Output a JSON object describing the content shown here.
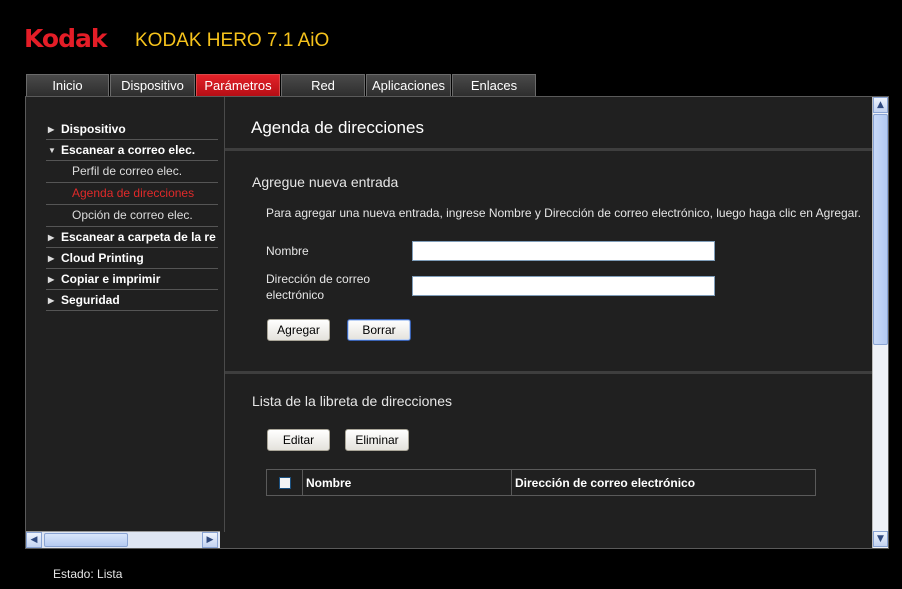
{
  "header": {
    "logo": "Kodak",
    "model": "KODAK HERO 7.1 AiO"
  },
  "tabs": [
    {
      "label": "Inicio",
      "active": false
    },
    {
      "label": "Dispositivo",
      "active": false
    },
    {
      "label": "Parámetros",
      "active": true
    },
    {
      "label": "Red",
      "active": false
    },
    {
      "label": "Aplicaciones",
      "active": false
    },
    {
      "label": "Enlaces",
      "active": false
    }
  ],
  "sidebar": {
    "items": [
      {
        "label": "Dispositivo",
        "expanded": false
      },
      {
        "label": "Escanear a correo elec.",
        "expanded": true
      },
      {
        "label": "Escanear a carpeta de la re",
        "expanded": false
      },
      {
        "label": "Cloud Printing",
        "expanded": false
      },
      {
        "label": "Copiar e imprimir",
        "expanded": false
      },
      {
        "label": "Seguridad",
        "expanded": false
      }
    ],
    "subitems": [
      {
        "label": "Perfil de correo elec.",
        "active": false
      },
      {
        "label": "Agenda de direcciones",
        "active": true
      },
      {
        "label": "Opción de correo elec.",
        "active": false
      }
    ]
  },
  "main": {
    "title": "Agenda de direcciones",
    "add_section": {
      "title": "Agregue nueva entrada",
      "instructions": "Para agregar una nueva entrada, ingrese Nombre y Dirección de correo electrónico, luego haga clic en Agregar.",
      "name_label": "Nombre",
      "name_value": "",
      "email_label_line1": "Dirección de correo",
      "email_label_line2": "electrónico",
      "email_value": "",
      "add_button": "Agregar",
      "clear_button": "Borrar"
    },
    "list_section": {
      "title": "Lista de la libreta de direcciones",
      "edit_button": "Editar",
      "delete_button": "Eliminar",
      "columns": [
        "Nombre",
        "Dirección de correo electrónico"
      ]
    }
  },
  "status": {
    "text": "Estado: Lista"
  },
  "scrollbar_glyphs": {
    "up": "▲",
    "down": "▼",
    "left": "◀",
    "right": "▶",
    "grip": "≡"
  },
  "colors": {
    "brand_red": "#e41d27",
    "model_yellow": "#f6c31c",
    "active_link": "#e02a2a"
  }
}
